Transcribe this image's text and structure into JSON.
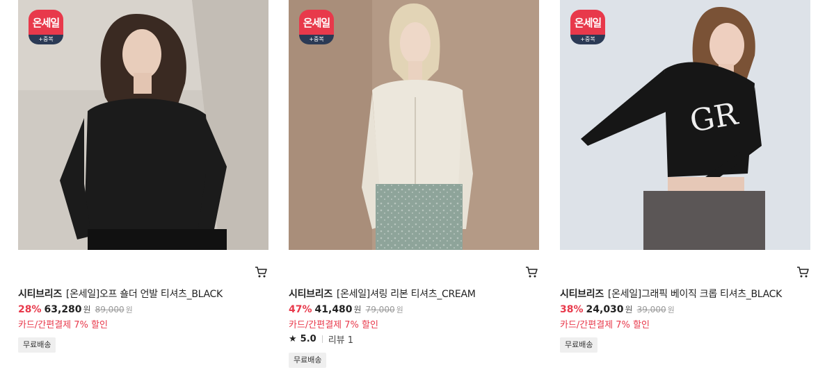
{
  "products": [
    {
      "badge": {
        "main": "온세일",
        "sub": "+중복"
      },
      "brand": "시티브리즈",
      "name": "[온세일]오프 숄더 언발 티셔츠_BLACK",
      "discount": "28%",
      "price": "63,280",
      "price_unit": "원",
      "original_price": "89,000",
      "original_unit": "원",
      "card_discount": "카드/간편결제 7% 할인",
      "shipping_tag": "무료배송",
      "cart_icon": "cart-icon",
      "colors": {
        "bg": "#cfcac3",
        "garment": "#1b1b1b"
      }
    },
    {
      "badge": {
        "main": "온세일",
        "sub": "+중복"
      },
      "brand": "시티브리즈",
      "name": "[온세일]셔링 리본 티셔츠_CREAM",
      "discount": "47%",
      "price": "41,480",
      "price_unit": "원",
      "original_price": "79,000",
      "original_unit": "원",
      "card_discount": "카드/간편결제 7% 할인",
      "rating": "5.0",
      "reviews": "리뷰 1",
      "shipping_tag": "무료배송",
      "cart_icon": "cart-icon",
      "colors": {
        "bg": "#b49a86",
        "garment": "#ece7dc"
      }
    },
    {
      "badge": {
        "main": "온세일",
        "sub": "+중복"
      },
      "brand": "시티브리즈",
      "name": "[온세일]그래픽 베이직 크롭 티셔츠_BLACK",
      "discount": "38%",
      "price": "24,030",
      "price_unit": "원",
      "original_price": "39,000",
      "original_unit": "원",
      "card_discount": "카드/간편결제 7% 할인",
      "shipping_tag": "무료배송",
      "cart_icon": "cart-icon",
      "colors": {
        "bg": "#dde2e8",
        "garment": "#161616"
      }
    }
  ]
}
